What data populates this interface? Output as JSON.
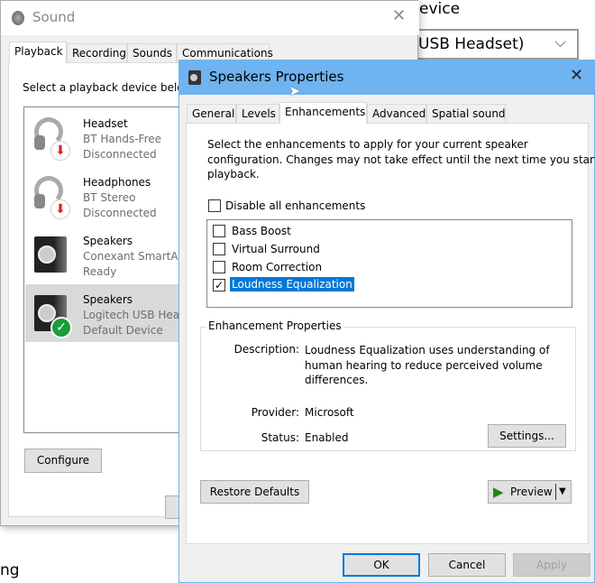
{
  "background": {
    "text_top": "evice",
    "combo_value": "USB Headset)",
    "text_bottom": "ng"
  },
  "sound": {
    "title": "Sound",
    "tabs": [
      "Playback",
      "Recording",
      "Sounds",
      "Communications"
    ],
    "prompt": "Select a playback device below",
    "devices": [
      {
        "name": "Headset",
        "detail": "BT Hands-Free",
        "status": "Disconnected",
        "icon": "headset-icon",
        "badge": "disconnected-arrow-icon"
      },
      {
        "name": "Headphones",
        "detail": "BT Stereo",
        "status": "Disconnected",
        "icon": "headphones-icon",
        "badge": "disconnected-arrow-icon"
      },
      {
        "name": "Speakers",
        "detail": "Conexant SmartAudio",
        "status": "Ready",
        "icon": "speaker-icon"
      },
      {
        "name": "Speakers",
        "detail": "Logitech USB Headset",
        "status": "Default Device",
        "icon": "speaker-icon",
        "badge": "default-check-icon",
        "selected": true
      }
    ],
    "configure": "Configure"
  },
  "props": {
    "title": "Speakers Properties",
    "tabs": [
      "General",
      "Levels",
      "Enhancements",
      "Advanced",
      "Spatial sound"
    ],
    "active_tab": "Enhancements",
    "intro_lines": [
      "Select the enhancements to apply for your current speaker",
      "configuration. Changes may not take effect until the next time you start",
      "playback."
    ],
    "disable_all": {
      "label": "Disable all enhancements",
      "checked": false
    },
    "enhancements": [
      {
        "label": "Bass Boost",
        "checked": false
      },
      {
        "label": "Virtual Surround",
        "checked": false
      },
      {
        "label": "Room Correction",
        "checked": false
      },
      {
        "label": "Loudness Equalization",
        "checked": true,
        "selected": true
      }
    ],
    "group_title": "Enhancement Properties",
    "description_label": "Description:",
    "description_lines": [
      "Loudness Equalization uses understanding of",
      "human hearing to reduce perceived volume",
      "differences."
    ],
    "provider_label": "Provider:",
    "provider": "Microsoft",
    "status_label": "Status:",
    "status": "Enabled",
    "settings": "Settings...",
    "restore": "Restore Defaults",
    "preview": "Preview",
    "ok": "OK",
    "cancel": "Cancel",
    "apply": "Apply"
  },
  "colors": {
    "title_active": "#6fb3f0",
    "selection": "#0078d7",
    "check_green": "#1a9e3a",
    "badge_red": "#e02020"
  }
}
